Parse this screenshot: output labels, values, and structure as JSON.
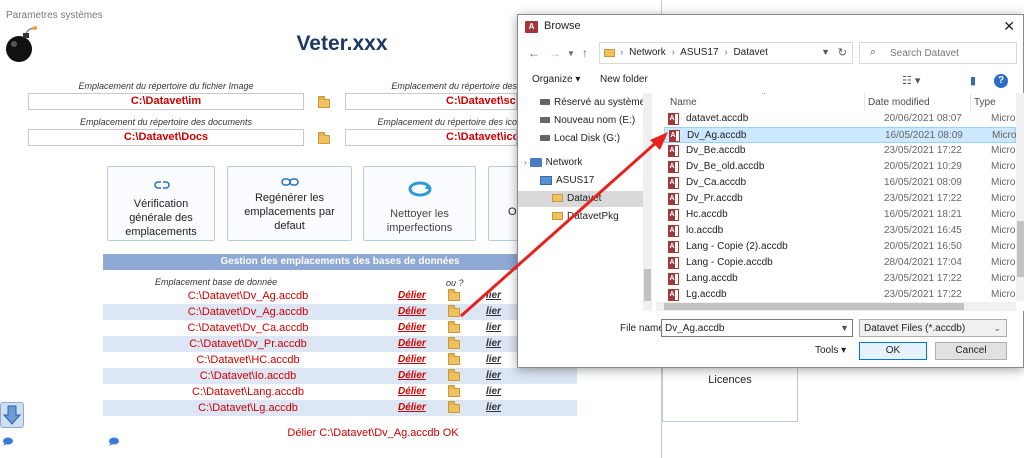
{
  "form": {
    "title": "Parametres systèmes",
    "app_title": "Veter.xxx",
    "fields": [
      {
        "label": "Emplacement du répertoire du fichier Image",
        "value": "C:\\Datavet\\im"
      },
      {
        "label": "Emplacement du répertoire des",
        "value": "C:\\Datavet\\scan"
      },
      {
        "label": "Emplacement du répertoire des documents",
        "value": "C:\\Datavet\\Docs"
      },
      {
        "label": "Emplacement du répertoire des ico",
        "value": "C:\\Datavet\\icon"
      }
    ],
    "buttons": [
      {
        "label": "Vérification générale des emplacements"
      },
      {
        "label": "Regénérer les emplacements par defaut"
      },
      {
        "label": "Nettoyer les imperfections"
      },
      {
        "label": "Op"
      }
    ],
    "db_panel": {
      "header": "Gestion des emplacements des bases de données",
      "col_location": "Emplacement base de donnée",
      "col_or": "ou ?",
      "rows": [
        {
          "path": "C:\\Datavet\\Dv_Ag.accdb",
          "delete": "Délier",
          "link": "lier"
        },
        {
          "path": "C:\\Datavet\\Dv_Ag.accdb",
          "delete": "Délier",
          "link": "lier"
        },
        {
          "path": "C:\\Datavet\\Dv_Ca.accdb",
          "delete": "Délier",
          "link": "lier"
        },
        {
          "path": "C:\\Datavet\\Dv_Pr.accdb",
          "delete": "Délier",
          "link": "lier"
        },
        {
          "path": "C:\\Datavet\\HC.accdb",
          "delete": "Délier",
          "link": "lier"
        },
        {
          "path": "C:\\Datavet\\Io.accdb",
          "delete": "Délier",
          "link": "lier"
        },
        {
          "path": "C:\\Datavet\\Lang.accdb",
          "delete": "Délier",
          "link": "lier"
        },
        {
          "path": "C:\\Datavet\\Lg.accdb",
          "delete": "Délier",
          "link": "lier"
        }
      ],
      "status": "Délier C:\\Datavet\\Dv_Ag.accdb OK"
    },
    "licences_label": "Licences"
  },
  "dialog": {
    "title": "Browse",
    "app_icon_letter": "A",
    "breadcrumb": [
      "Network",
      "ASUS17",
      "Datavet"
    ],
    "search_placeholder": "Search Datavet",
    "organize": "Organize",
    "new_folder": "New folder",
    "nav_items": [
      {
        "label": "Réservé au système (I"
      },
      {
        "label": "Nouveau nom (E:)"
      },
      {
        "label": "Local Disk (G:)"
      },
      {
        "label": "Network"
      },
      {
        "label": "ASUS17"
      },
      {
        "label": "Datavet"
      },
      {
        "label": "DatavetPkg"
      }
    ],
    "columns": {
      "name": "Name",
      "date": "Date modified",
      "type": "Type"
    },
    "files": [
      {
        "name": "datavet.accdb",
        "date": "20/06/2021 08:07",
        "type": "Microso"
      },
      {
        "name": "Dv_Ag.accdb",
        "date": "16/05/2021 08:09",
        "type": "Microso"
      },
      {
        "name": "Dv_Be.accdb",
        "date": "23/05/2021 17:22",
        "type": "Microso"
      },
      {
        "name": "Dv_Be_old.accdb",
        "date": "20/05/2021 10:29",
        "type": "Microso"
      },
      {
        "name": "Dv_Ca.accdb",
        "date": "16/05/2021 08:09",
        "type": "Microso"
      },
      {
        "name": "Dv_Pr.accdb",
        "date": "23/05/2021 17:22",
        "type": "Microso"
      },
      {
        "name": "Hc.accdb",
        "date": "16/05/2021 18:21",
        "type": "Microso"
      },
      {
        "name": "lo.accdb",
        "date": "23/05/2021 16:45",
        "type": "Microso"
      },
      {
        "name": "Lang - Copie (2).accdb",
        "date": "20/05/2021 16:50",
        "type": "Microso"
      },
      {
        "name": "Lang - Copie.accdb",
        "date": "28/04/2021 17:04",
        "type": "Microso"
      },
      {
        "name": "Lang.accdb",
        "date": "23/05/2021 17:22",
        "type": "Microso"
      },
      {
        "name": "Lg.accdb",
        "date": "23/05/2021 17:22",
        "type": "Microso"
      }
    ],
    "selected_index": 1,
    "file_name_label": "File name:",
    "file_name_value": "Dv_Ag.accdb",
    "file_type_value": "Datavet Files (*.accdb)",
    "tools_label": "Tools",
    "ok_label": "OK",
    "cancel_label": "Cancel"
  },
  "colors": {
    "accent_red": "#d00000",
    "header_blue": "#8ea9d4",
    "row_alt": "#dce6f4",
    "title_blue": "#1f3864",
    "selection": "#cce8ff"
  }
}
